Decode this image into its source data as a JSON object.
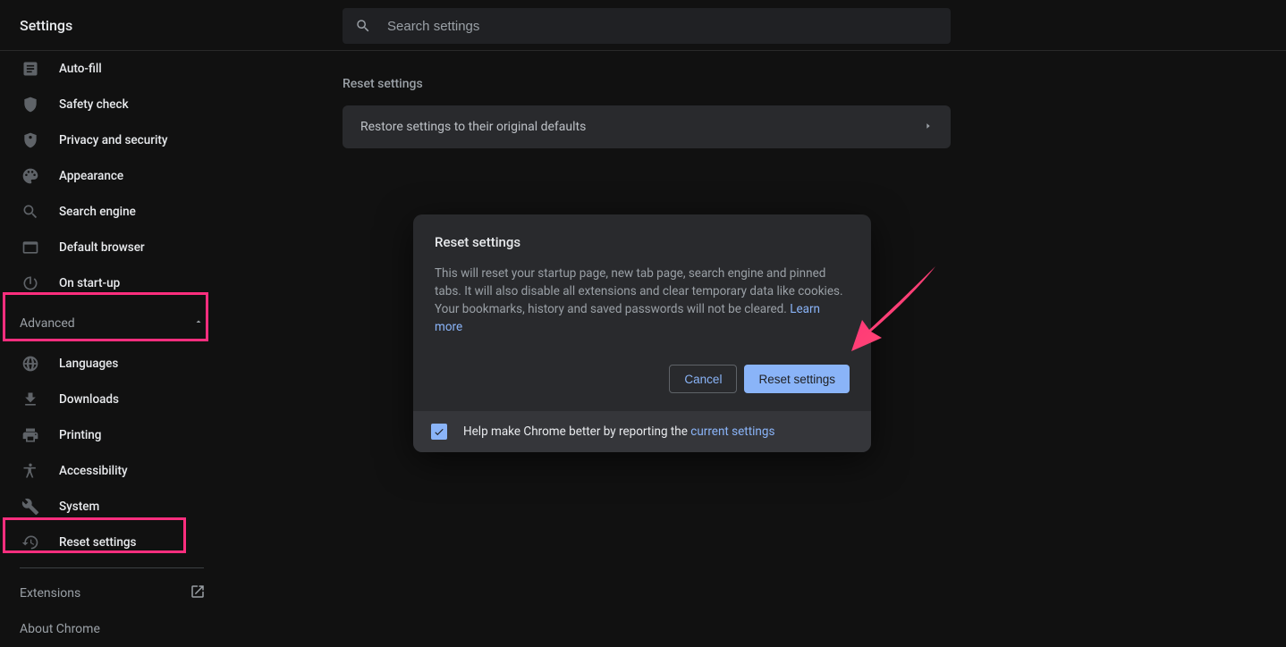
{
  "header": {
    "title": "Settings"
  },
  "search": {
    "placeholder": "Search settings"
  },
  "sidebar": {
    "items": [
      {
        "label": "Auto-fill",
        "icon": "autofill"
      },
      {
        "label": "Safety check",
        "icon": "shield"
      },
      {
        "label": "Privacy and security",
        "icon": "security"
      },
      {
        "label": "Appearance",
        "icon": "palette"
      },
      {
        "label": "Search engine",
        "icon": "search"
      },
      {
        "label": "Default browser",
        "icon": "browser"
      },
      {
        "label": "On start-up",
        "icon": "power"
      }
    ],
    "advanced_label": "Advanced",
    "advanced_items": [
      {
        "label": "Languages",
        "icon": "globe"
      },
      {
        "label": "Downloads",
        "icon": "download"
      },
      {
        "label": "Printing",
        "icon": "print"
      },
      {
        "label": "Accessibility",
        "icon": "accessibility"
      },
      {
        "label": "System",
        "icon": "wrench"
      },
      {
        "label": "Reset settings",
        "icon": "restore"
      }
    ],
    "footer": {
      "extensions": "Extensions",
      "about": "About Chrome"
    }
  },
  "main": {
    "section_title": "Reset settings",
    "row_label": "Restore settings to their original defaults"
  },
  "dialog": {
    "title": "Reset settings",
    "body": "This will reset your startup page, new tab page, search engine and pinned tabs. It will also disable all extensions and clear temporary data like cookies. Your bookmarks, history and saved passwords will not be cleared. ",
    "learn_more": "Learn more",
    "cancel": "Cancel",
    "confirm": "Reset settings",
    "footer_text": "Help make Chrome better by reporting the ",
    "footer_link": "current settings",
    "checkbox_checked": true
  }
}
